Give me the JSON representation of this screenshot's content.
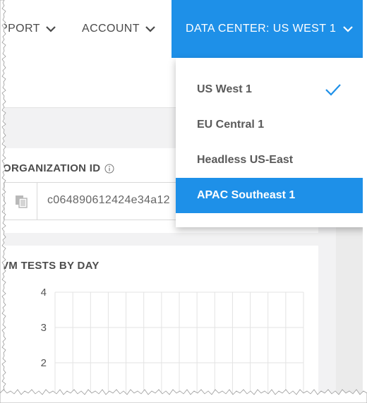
{
  "header": {
    "support_label": "PPORT",
    "account_label": "ACCOUNT",
    "data_center_label": "DATA CENTER: US WEST 1"
  },
  "data_center_menu": {
    "items": [
      {
        "label": "US West 1",
        "checked": true
      },
      {
        "label": "EU Central 1"
      },
      {
        "label": "Headless US-East"
      },
      {
        "label": "APAC Southeast 1",
        "highlighted": true
      }
    ]
  },
  "organization": {
    "title": "ORGANIZATION ID",
    "id_value": "c064890612424e34a12"
  },
  "chart": {
    "title": "VM TESTS BY DAY"
  },
  "chart_data": {
    "type": "bar",
    "title": "VM TESTS BY DAY",
    "y_ticks": [
      "4",
      "3",
      "2"
    ],
    "ylim": [
      1,
      4
    ],
    "grid": true
  },
  "colors": {
    "accent": "#1e90e8",
    "text": "#4a4a4a"
  }
}
